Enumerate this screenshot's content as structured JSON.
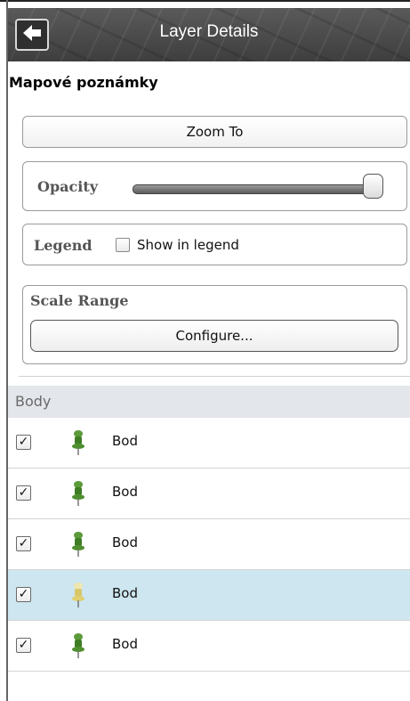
{
  "header": {
    "title": "Layer Details",
    "back_icon": "arrow-left-icon"
  },
  "layer": {
    "name": "Mapové poznámky"
  },
  "actions": {
    "zoom_to_label": "Zoom To"
  },
  "opacity": {
    "label": "Opacity",
    "value_fraction": 1.0
  },
  "legend": {
    "label": "Legend",
    "checkbox_label": "Show in legend",
    "checked": false
  },
  "scale_range": {
    "label": "Scale Range",
    "configure_label": "Configure..."
  },
  "features": {
    "section_title": "Body",
    "items": [
      {
        "label": "Bod",
        "checked": true,
        "icon": "green-pushpin-icon",
        "selected": false
      },
      {
        "label": "Bod",
        "checked": true,
        "icon": "green-pushpin-icon",
        "selected": false
      },
      {
        "label": "Bod",
        "checked": true,
        "icon": "green-pushpin-icon",
        "selected": false
      },
      {
        "label": "Bod",
        "checked": true,
        "icon": "yellow-pushpin-icon",
        "selected": true
      },
      {
        "label": "Bod",
        "checked": true,
        "icon": "green-pushpin-icon",
        "selected": false
      }
    ]
  },
  "colors": {
    "selected_row": "#cde6ef",
    "section_header": "#e3e6ea",
    "header_bar": "#4c4c4c"
  }
}
